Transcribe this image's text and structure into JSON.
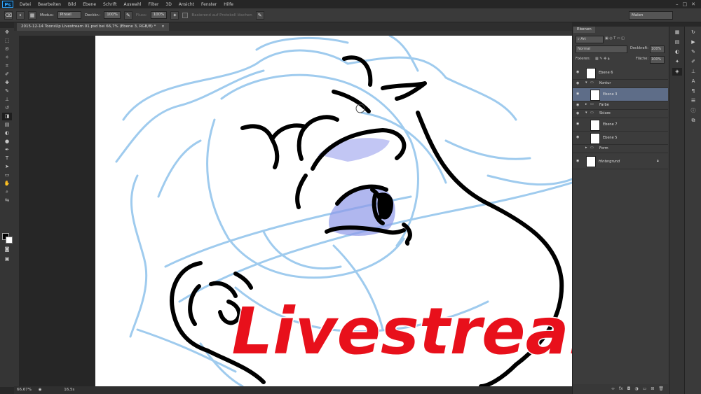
{
  "app": {
    "logo": "Ps"
  },
  "menu": {
    "items": [
      "Datei",
      "Bearbeiten",
      "Bild",
      "Ebene",
      "Schrift",
      "Auswahl",
      "Filter",
      "3D",
      "Ansicht",
      "Fenster",
      "Hilfe"
    ],
    "window_controls": [
      "–",
      "□",
      "✕"
    ]
  },
  "options": {
    "mode_label": "Modus:",
    "mode_value": "Pinsel",
    "opacity_label": "Deckkr.:",
    "opacity_value": "100%",
    "flow_label": "Fluss:",
    "flow_value": "100%",
    "history_label": "Basierend auf Protokoll löschen",
    "workspace": "Malen"
  },
  "document": {
    "tab_title": "2015-12-14 ToonsUp Livestream 01.psd bei 66,7% (Ebene 3, RGB/8) *",
    "tab_close": "×"
  },
  "status": {
    "zoom": "66,67%",
    "info": "16,5s"
  },
  "layers_panel": {
    "tab": "Ebenen",
    "filter": "Art",
    "blend_mode": "Normal",
    "opacity_label": "Deckkraft:",
    "opacity_value": "100%",
    "lock_label": "Fixieren:",
    "fill_label": "Fläche:",
    "fill_value": "100%",
    "layers": [
      {
        "name": "Ebene 6",
        "type": "layer",
        "indent": 0,
        "selected": false,
        "visible": true
      },
      {
        "name": "Kontur",
        "type": "group",
        "indent": 0,
        "selected": false,
        "visible": true
      },
      {
        "name": "Ebene 3",
        "type": "layer",
        "indent": 1,
        "selected": true,
        "visible": true
      },
      {
        "name": "Farbe",
        "type": "group",
        "indent": 0,
        "selected": false,
        "visible": true
      },
      {
        "name": "Skizze",
        "type": "group",
        "indent": 0,
        "selected": false,
        "visible": true
      },
      {
        "name": "Ebene 7",
        "type": "layer",
        "indent": 1,
        "selected": false,
        "visible": true
      },
      {
        "name": "Ebene 5",
        "type": "layer",
        "indent": 1,
        "selected": false,
        "visible": true
      },
      {
        "name": "Form",
        "type": "group",
        "indent": 0,
        "selected": false,
        "visible": false
      },
      {
        "name": "Hintergrund",
        "type": "background",
        "indent": 0,
        "selected": false,
        "visible": true
      }
    ],
    "footer_icons": [
      "link-icon",
      "fx-icon",
      "mask-icon",
      "adjustment-icon",
      "folder-icon",
      "new-layer-icon",
      "trash-icon"
    ]
  },
  "overlay_text": "Livestream!",
  "colors": {
    "sketch": "#9fcbee",
    "ink": "#000000",
    "eye_fill": "#8f98e8",
    "overlay": "#e8101b",
    "selected_layer": "#5e6d88"
  }
}
